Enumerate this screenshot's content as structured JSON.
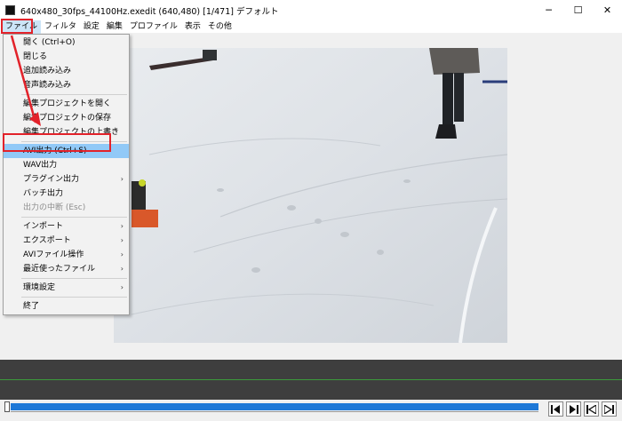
{
  "window": {
    "title": "640x480_30fps_44100Hz.exedit (640,480)  [1/471]  デフォルト",
    "minimize_glyph": "─",
    "maximize_glyph": "☐",
    "close_glyph": "✕"
  },
  "menubar": {
    "items": [
      {
        "label": "ファイル",
        "active": true
      },
      {
        "label": "フィルタ"
      },
      {
        "label": "設定"
      },
      {
        "label": "編集"
      },
      {
        "label": "プロファイル"
      },
      {
        "label": "表示"
      },
      {
        "label": "その他"
      }
    ]
  },
  "file_menu": {
    "items": [
      {
        "label": "開く (Ctrl+O)"
      },
      {
        "label": "閉じる"
      },
      {
        "label": "追加読み込み"
      },
      {
        "label": "音声読み込み"
      },
      {
        "separator": true
      },
      {
        "label": "編集プロジェクトを開く"
      },
      {
        "label": "編集プロジェクトの保存"
      },
      {
        "label": "編集プロジェクトの上書き"
      },
      {
        "separator": true
      },
      {
        "label": "AVI出力 (Ctrl+S)",
        "highlight": true
      },
      {
        "label": "WAV出力"
      },
      {
        "label": "プラグイン出力",
        "submenu": true
      },
      {
        "label": "バッチ出力"
      },
      {
        "label": "出力の中断 (Esc)",
        "disabled": true
      },
      {
        "separator": true
      },
      {
        "label": "インポート",
        "submenu": true
      },
      {
        "label": "エクスポート",
        "submenu": true
      },
      {
        "label": "AVIファイル操作",
        "submenu": true
      },
      {
        "label": "最近使ったファイル",
        "submenu": true
      },
      {
        "separator": true
      },
      {
        "label": "環境設定",
        "submenu": true
      },
      {
        "separator": true
      },
      {
        "label": "終了"
      }
    ]
  },
  "colors": {
    "highlight": "#91c9f7",
    "annotation": "#e2222a",
    "seekbar": "#1e78d7",
    "timeline": "#3e3e3e"
  },
  "controls": {
    "icons": [
      "frame-back-icon",
      "frame-forward-icon",
      "go-start-icon",
      "go-end-icon"
    ]
  }
}
